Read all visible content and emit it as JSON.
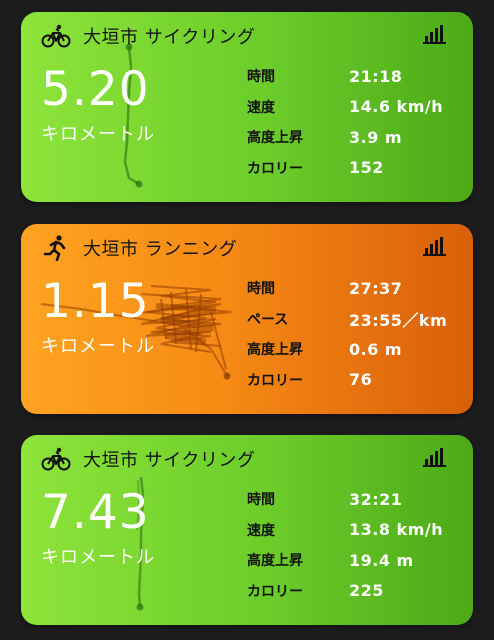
{
  "cards": [
    {
      "title": "大垣市 サイクリング",
      "activity_icon": "bicycle-icon",
      "stats_icon": "bar-chart-icon",
      "distance": "5.20",
      "unit": "キロメートル",
      "theme_color": "#7ed934",
      "stats": [
        {
          "label": "時間",
          "value": "21:18"
        },
        {
          "label": "速度",
          "value": "14.6 km/h"
        },
        {
          "label": "高度上昇",
          "value": "3.9 m"
        },
        {
          "label": "カロリー",
          "value": "152"
        }
      ]
    },
    {
      "title": "大垣市 ランニング",
      "activity_icon": "running-person-icon",
      "stats_icon": "bar-chart-icon",
      "distance": "1.15",
      "unit": "キロメートル",
      "theme_color": "#f68a14",
      "stats": [
        {
          "label": "時間",
          "value": "27:37"
        },
        {
          "label": "ペース",
          "value": "23:55／km"
        },
        {
          "label": "高度上昇",
          "value": "0.6 m"
        },
        {
          "label": "カロリー",
          "value": "76"
        }
      ]
    },
    {
      "title": "大垣市 サイクリング",
      "activity_icon": "bicycle-icon",
      "stats_icon": "bar-chart-icon",
      "distance": "7.43",
      "unit": "キロメートル",
      "theme_color": "#7ed934",
      "stats": [
        {
          "label": "時間",
          "value": "32:21"
        },
        {
          "label": "速度",
          "value": "13.8 km/h"
        },
        {
          "label": "高度上昇",
          "value": "19.4 m"
        },
        {
          "label": "カロリー",
          "value": "225"
        }
      ]
    }
  ]
}
